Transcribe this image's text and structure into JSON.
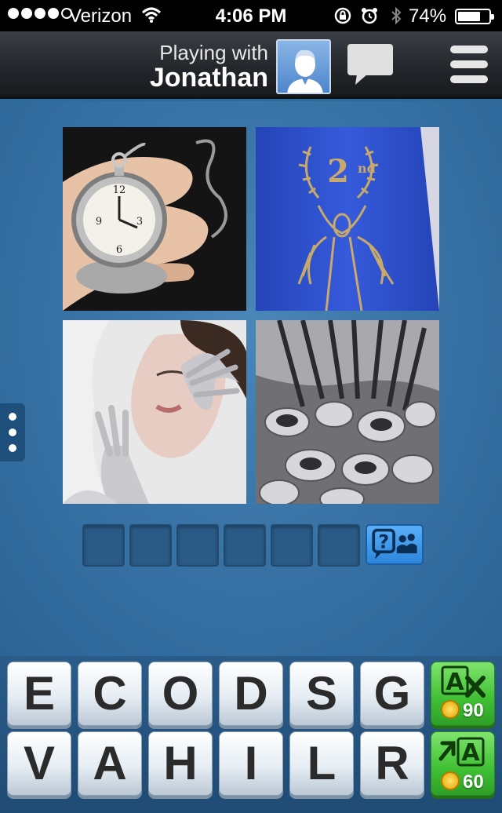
{
  "status_bar": {
    "carrier": "Verizon",
    "time": "4:06 PM",
    "battery_percent": "74%",
    "battery_level": 0.74,
    "signal_dots_filled": 4,
    "signal_dots_total": 5
  },
  "header": {
    "playing_with_label": "Playing with",
    "opponent_name": "Jonathan",
    "avatar_icon": "user-avatar-icon",
    "chat_icon": "chat-bubble-icon",
    "menu_icon": "hamburger-menu-icon"
  },
  "puzzle": {
    "pictures": [
      {
        "icon": "pocket-watch-photo"
      },
      {
        "icon": "second-place-ribbon-photo"
      },
      {
        "icon": "silver-painted-woman-photo"
      },
      {
        "icon": "silverware-photo"
      }
    ],
    "answer_slots": [
      "",
      "",
      "",
      "",
      "",
      ""
    ],
    "ask_friend_icon": "ask-friend-icon"
  },
  "keyboard": {
    "row1": [
      "E",
      "C",
      "O",
      "D",
      "S",
      "G"
    ],
    "row2": [
      "V",
      "A",
      "H",
      "I",
      "L",
      "R"
    ],
    "hints": {
      "remove_letters": {
        "icon": "remove-letters-icon",
        "cost": "90",
        "glyph": "A"
      },
      "reveal_letter": {
        "icon": "reveal-letter-icon",
        "cost": "60",
        "glyph": "A"
      }
    }
  },
  "colors": {
    "background_blue": "#3a74a6",
    "hint_green": "#3fbf33",
    "ask_blue": "#2d86dc"
  }
}
